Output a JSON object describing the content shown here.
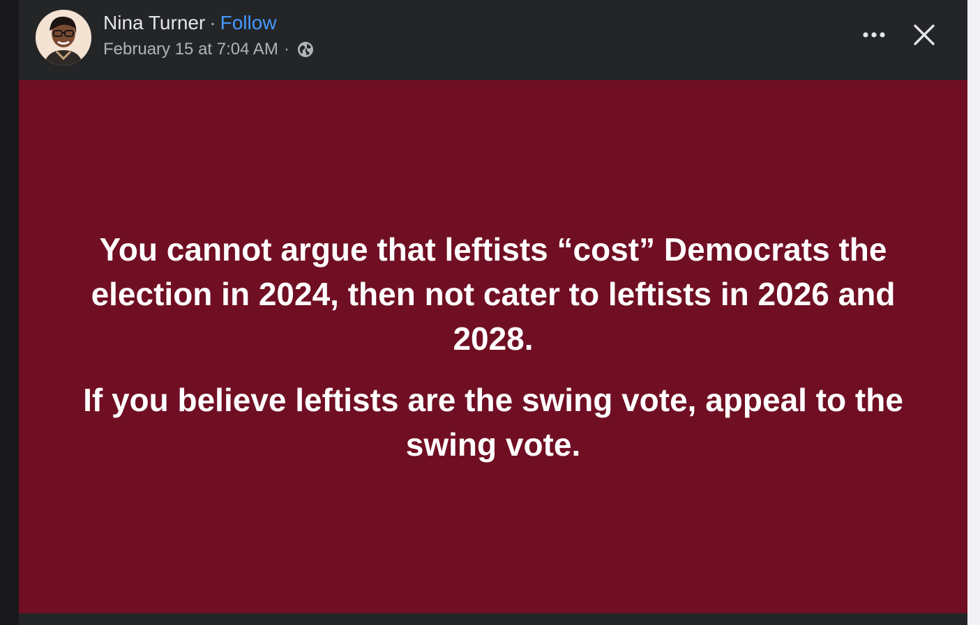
{
  "post": {
    "author": "Nina Turner",
    "separator": "·",
    "follow_label": "Follow",
    "timestamp": "February 15 at 7:04 AM",
    "audience_icon": "globe-icon",
    "text_paragraphs": [
      "You cannot argue that leftists “cost” Democrats the election in 2024, then not cater to leftists in 2026 and 2028.",
      "If you believe leftists are the swing vote, appeal to the swing vote."
    ],
    "background_color": "#700f23"
  },
  "toolbar": {
    "more_icon": "more-options-icon",
    "close_icon": "close-icon"
  },
  "colors": {
    "follow": "#4599ff",
    "header_bg": "#242527",
    "name_text": "#e4e6eb",
    "meta_text": "#b0b3b8"
  }
}
